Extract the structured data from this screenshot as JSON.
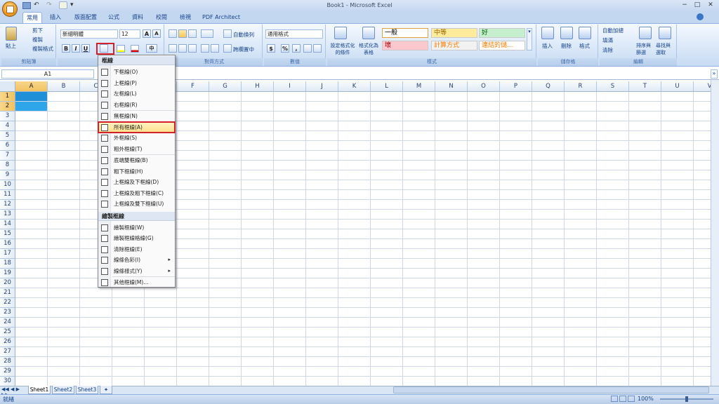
{
  "window": {
    "title": "Book1 - Microsoft Excel",
    "controls": {
      "minimize": "−",
      "maximize": "□",
      "close": "✕"
    }
  },
  "qat": {
    "undo": "↶",
    "redo": "↷",
    "more": "▾"
  },
  "tabs": [
    {
      "label": "常用",
      "active": true
    },
    {
      "label": "插入"
    },
    {
      "label": "版面配置"
    },
    {
      "label": "公式"
    },
    {
      "label": "資料"
    },
    {
      "label": "校閱"
    },
    {
      "label": "檢視"
    },
    {
      "label": "PDF Architect"
    }
  ],
  "ribbon": {
    "clipboard": {
      "paste": "貼上",
      "cut": "剪下",
      "copy": "複製",
      "format_painter": "複製格式",
      "label": "剪貼簿"
    },
    "font": {
      "name": "新細明體",
      "size": "12",
      "bold": "B",
      "italic": "I",
      "underline": "U",
      "grow": "A",
      "shrink": "A",
      "label": "字型"
    },
    "alignment": {
      "wrap": "自動換列",
      "merge": "跨欄置中",
      "label": "對齊方式"
    },
    "number": {
      "format": "通用格式",
      "currency": "$",
      "percent": "%",
      "comma": ",",
      "label": "數值"
    },
    "styles": {
      "conditional": "設定格式化的條件",
      "format_table": "格式化為表格",
      "cells": [
        {
          "text": "一般",
          "bg": "#ffffff",
          "color": "#000000"
        },
        {
          "text": "中等",
          "bg": "#ffeb9c",
          "color": "#9c6500"
        },
        {
          "text": "好",
          "bg": "#c6efce",
          "color": "#006100"
        },
        {
          "text": "壞",
          "bg": "#ffc7ce",
          "color": "#9c0006"
        },
        {
          "text": "計算方式",
          "bg": "#f2f2f2",
          "color": "#fa7d00"
        },
        {
          "text": "連結的儲...",
          "bg": "#ffffff",
          "color": "#fa7d00"
        }
      ],
      "label": "樣式"
    },
    "cells": {
      "insert": "插入",
      "delete": "刪除",
      "format": "格式",
      "label": "儲存格"
    },
    "editing": {
      "autosum": "自動加總",
      "fill": "填滿",
      "clear": "清除",
      "sort": "排序與篩選",
      "find": "尋找與選取",
      "label": "編輯"
    }
  },
  "formula": {
    "namebox": "A1",
    "fx": "fx",
    "content": ""
  },
  "grid": {
    "columns": [
      "A",
      "B",
      "C",
      "D",
      "E",
      "F",
      "G",
      "H",
      "I",
      "J",
      "K",
      "L",
      "M",
      "N",
      "O",
      "P",
      "Q",
      "R",
      "S",
      "T",
      "U",
      "V"
    ],
    "rows": [
      "1",
      "2",
      "3",
      "4",
      "5",
      "6",
      "7",
      "8",
      "9",
      "10",
      "11",
      "12",
      "13",
      "14",
      "15",
      "16",
      "17",
      "18",
      "19",
      "20",
      "21",
      "22",
      "23",
      "24",
      "25",
      "26",
      "27",
      "28",
      "29",
      "30"
    ],
    "selected_range": "A1:A2"
  },
  "borders_menu": {
    "header1": "框線",
    "items1": [
      {
        "label": "下框線(O)",
        "name": "bottom-border"
      },
      {
        "label": "上框線(P)",
        "name": "top-border"
      },
      {
        "label": "左框線(L)",
        "name": "left-border"
      },
      {
        "label": "右框線(R)",
        "name": "right-border"
      },
      {
        "label": "無框線(N)",
        "name": "no-border",
        "sep": true
      },
      {
        "label": "所有框線(A)",
        "name": "all-borders",
        "highlight": true
      },
      {
        "label": "外框線(S)",
        "name": "outside-borders"
      },
      {
        "label": "粗外框線(T)",
        "name": "thick-box-border"
      },
      {
        "label": "底端雙框線(B)",
        "name": "bottom-double-border",
        "sep": true
      },
      {
        "label": "粗下框線(H)",
        "name": "thick-bottom-border"
      },
      {
        "label": "上框線及下框線(D)",
        "name": "top-bottom-border"
      },
      {
        "label": "上框線及粗下框線(C)",
        "name": "top-thick-bottom-border"
      },
      {
        "label": "上框線及雙下框線(U)",
        "name": "top-double-bottom-border"
      }
    ],
    "header2": "繪製框線",
    "items2": [
      {
        "label": "繪製框線(W)",
        "name": "draw-border"
      },
      {
        "label": "繪製框線格線(G)",
        "name": "draw-border-grid"
      },
      {
        "label": "清除框線(E)",
        "name": "erase-border"
      },
      {
        "label": "線條色彩(I)",
        "name": "line-color",
        "submenu": true
      },
      {
        "label": "線條樣式(Y)",
        "name": "line-style",
        "submenu": true
      },
      {
        "label": "其他框線(M)...",
        "name": "more-borders",
        "sep": true
      }
    ]
  },
  "sheets": [
    {
      "label": "Sheet1",
      "active": true
    },
    {
      "label": "Sheet2"
    },
    {
      "label": "Sheet3"
    }
  ],
  "status": {
    "text": "就緒",
    "zoom": "100%"
  }
}
